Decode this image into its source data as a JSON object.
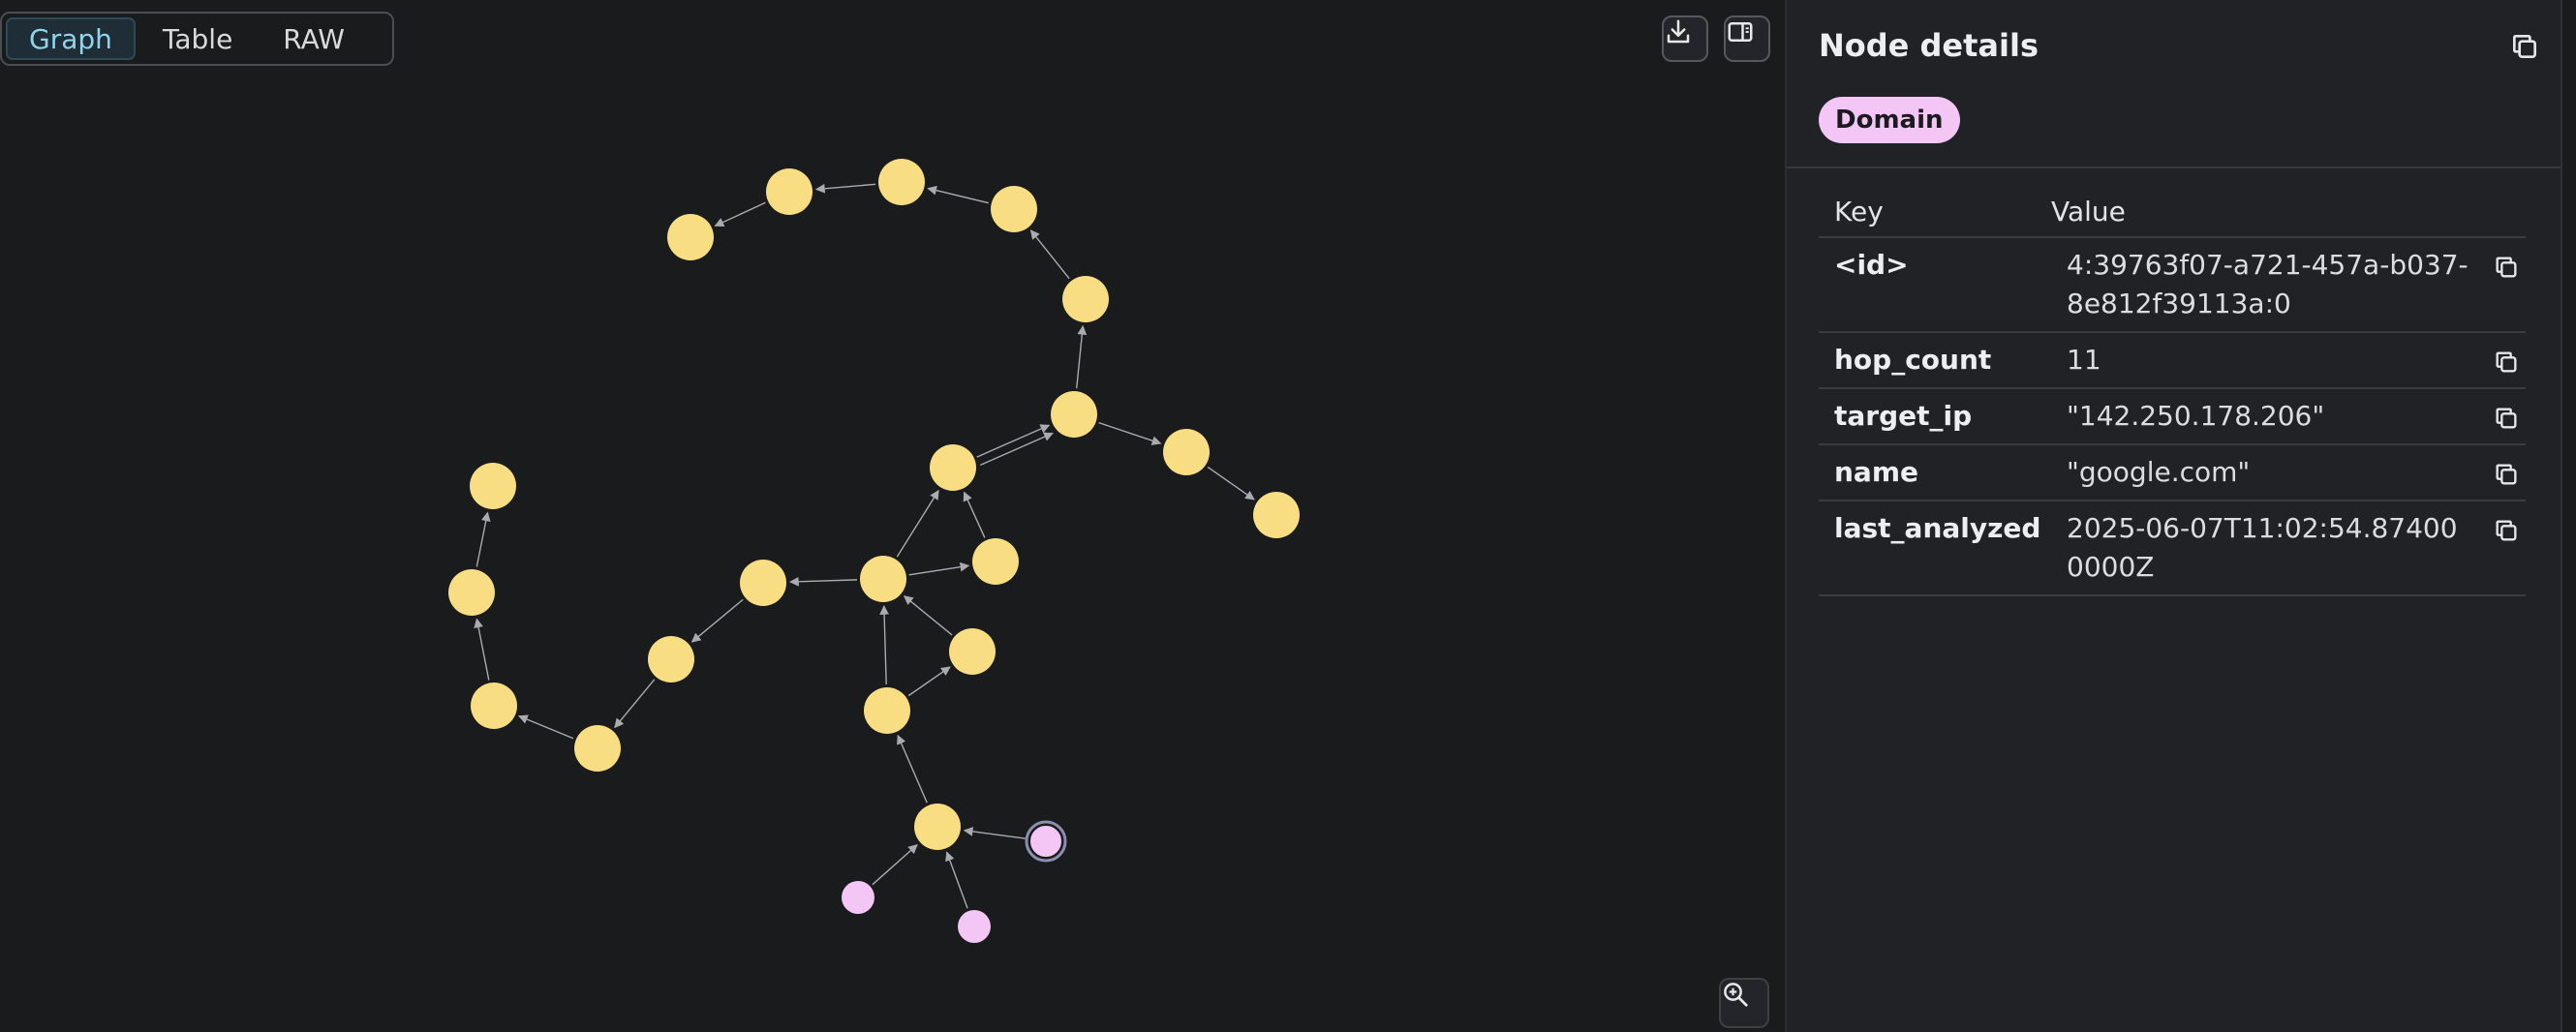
{
  "view_tabs": {
    "graph": "Graph",
    "table": "Table",
    "raw": "RAW",
    "active": "graph"
  },
  "toolbar": {
    "download_icon": "download-icon",
    "toggle_panel_icon": "panel-toggle-icon",
    "zoom_icon": "zoom-in-icon"
  },
  "colors": {
    "domain_node": "#f9dd82",
    "ip_node": "#f4c6f6",
    "edge": "#a9abae",
    "canvas_bg": "#1a1b1d",
    "panel_bg": "#202225"
  },
  "panel": {
    "title": "Node details",
    "label_chip": "Domain",
    "headers": {
      "key": "Key",
      "value": "Value"
    },
    "properties": [
      {
        "key": "<id>",
        "value": "4:39763f07-a721-457a-b037-8e812f39113a:0"
      },
      {
        "key": "hop_count",
        "value": "11"
      },
      {
        "key": "target_ip",
        "value": "\"142.250.178.206\""
      },
      {
        "key": "name",
        "value": "\"google.com\""
      },
      {
        "key": "last_analyzed",
        "value": "2025-06-07T11:02:54.874000000Z"
      }
    ]
  },
  "graph": {
    "nodes": [
      {
        "id": "n1",
        "type": "domain"
      },
      {
        "id": "n2",
        "type": "domain"
      },
      {
        "id": "n3",
        "type": "domain"
      },
      {
        "id": "n4",
        "type": "domain"
      },
      {
        "id": "n5",
        "type": "domain"
      },
      {
        "id": "n6",
        "type": "domain"
      },
      {
        "id": "n7",
        "type": "domain"
      },
      {
        "id": "n8",
        "type": "domain"
      },
      {
        "id": "n9",
        "type": "domain"
      },
      {
        "id": "n10",
        "type": "domain"
      },
      {
        "id": "n11",
        "type": "domain"
      },
      {
        "id": "n12",
        "type": "domain"
      },
      {
        "id": "n13",
        "type": "domain"
      },
      {
        "id": "n14",
        "type": "domain"
      },
      {
        "id": "n15",
        "type": "domain"
      },
      {
        "id": "n16",
        "type": "domain"
      },
      {
        "id": "n17",
        "type": "domain"
      },
      {
        "id": "n18",
        "type": "domain"
      },
      {
        "id": "n19",
        "type": "domain"
      },
      {
        "id": "n20",
        "type": "domain"
      },
      {
        "id": "n21",
        "type": "domain"
      },
      {
        "id": "n22",
        "type": "ip",
        "selected": true
      },
      {
        "id": "n23",
        "type": "ip"
      },
      {
        "id": "n24",
        "type": "ip"
      }
    ],
    "edges": [
      [
        "n2",
        "n1"
      ],
      [
        "n3",
        "n2"
      ],
      [
        "n4",
        "n3"
      ],
      [
        "n5",
        "n4"
      ],
      [
        "n6",
        "n5"
      ],
      [
        "n6",
        "n7"
      ],
      [
        "n7",
        "n8"
      ],
      [
        "n9",
        "n6"
      ],
      [
        "n9",
        "n6"
      ],
      [
        "n10",
        "n9"
      ],
      [
        "n11",
        "n10"
      ],
      [
        "n11",
        "n9"
      ],
      [
        "n11",
        "n12"
      ],
      [
        "n13",
        "n11"
      ],
      [
        "n14",
        "n11"
      ],
      [
        "n14",
        "n13"
      ],
      [
        "n12",
        "n15"
      ],
      [
        "n15",
        "n16"
      ],
      [
        "n16",
        "n17"
      ],
      [
        "n17",
        "n18"
      ],
      [
        "n18",
        "n19"
      ],
      [
        "n20",
        "n14"
      ],
      [
        "n22",
        "n20"
      ],
      [
        "n23",
        "n20"
      ],
      [
        "n24",
        "n20"
      ]
    ]
  }
}
